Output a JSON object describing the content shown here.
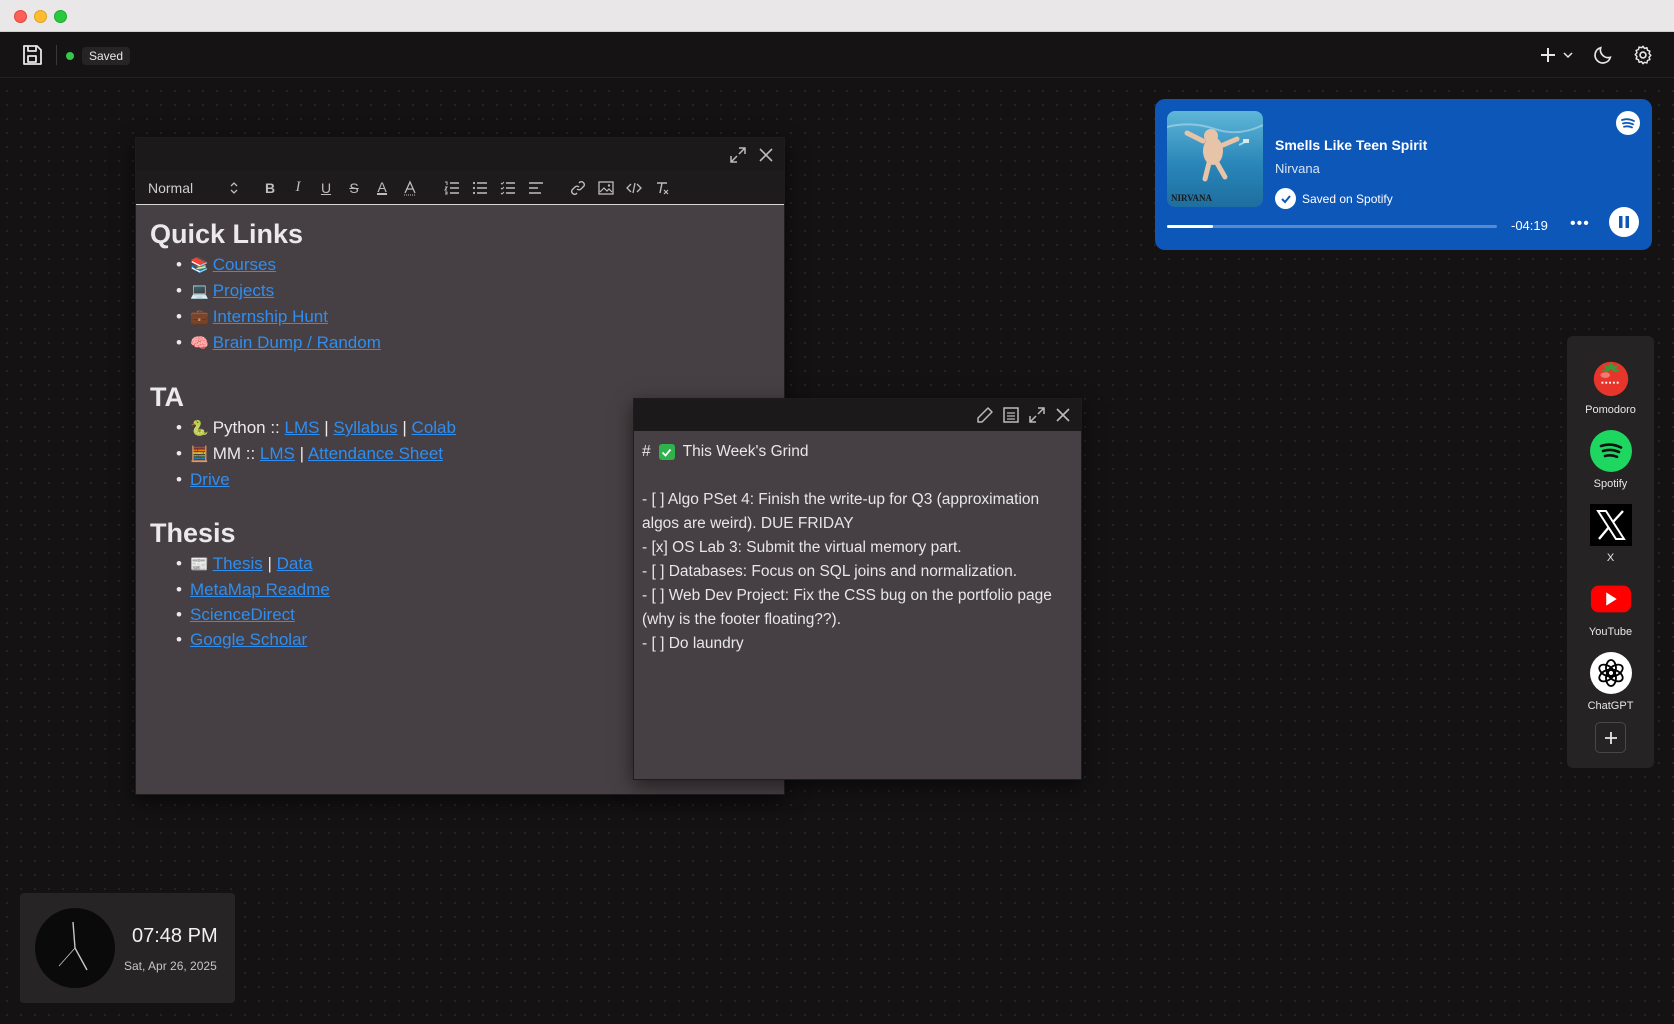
{
  "topbar": {
    "status_label": "Saved",
    "status_color": "#35c64a"
  },
  "editor": {
    "format_select": "Normal",
    "toolbar_icons": [
      "bold-icon",
      "italic-icon",
      "underline-icon",
      "strikethrough-icon",
      "text-color-icon",
      "highlight-icon",
      "ordered-list-icon",
      "bullet-list-icon",
      "check-list-icon",
      "align-icon",
      "link-icon",
      "image-icon",
      "code-icon",
      "clear-format-icon"
    ],
    "quick_links": {
      "heading": "Quick Links",
      "items": [
        {
          "emoji": "📚",
          "label": "Courses"
        },
        {
          "emoji": "💻",
          "label": "Projects"
        },
        {
          "emoji": "💼",
          "label": "Internship Hunt"
        },
        {
          "emoji": "🧠",
          "label": "Brain Dump / Random"
        }
      ]
    },
    "ta": {
      "heading": "TA",
      "python": {
        "emoji": "🐍",
        "prefix": "Python ::",
        "links": [
          "LMS",
          "Syllabus",
          "Colab"
        ],
        "separator": "|"
      },
      "mm": {
        "emoji": "🧮",
        "prefix": "MM ::",
        "links": [
          "LMS",
          "Attendance Sheet"
        ],
        "separator": "|"
      },
      "drive": "Drive"
    },
    "thesis": {
      "heading": "Thesis",
      "row1": {
        "emoji": "📰",
        "links": [
          "Thesis",
          "Data"
        ],
        "separator": "|"
      },
      "items": [
        "MetaMap Readme",
        "ScienceDirect",
        "Google Scholar"
      ]
    }
  },
  "note": {
    "hash": "#",
    "title": "This Week's Grind",
    "lines": [
      "- [ ] Algo PSet 4: Finish the write-up for Q3 (approximation algos are weird). DUE FRIDAY",
      "- [x] OS Lab 3: Submit the virtual memory part.",
      "- [ ] Databases: Focus on SQL joins and normalization.",
      "- [ ] Web Dev Project: Fix the CSS bug on the portfolio page (why is the footer floating??).",
      "- [ ] Do laundry"
    ]
  },
  "spotify": {
    "track": "Smells Like Teen Spirit",
    "artist": "Nirvana",
    "saved_label": "Saved on Spotify",
    "remaining": "-04:19",
    "progress": 0.14,
    "album_caption": "NIRVANA",
    "bg_color": "#0d57b8"
  },
  "dock": {
    "apps": [
      {
        "label": "Pomodoro",
        "icon": "tomato-icon"
      },
      {
        "label": "Spotify",
        "icon": "spotify-icon"
      },
      {
        "label": "X",
        "icon": "x-icon"
      },
      {
        "label": "YouTube",
        "icon": "youtube-icon"
      },
      {
        "label": "ChatGPT",
        "icon": "chatgpt-icon"
      }
    ]
  },
  "clock": {
    "time": "07:48 PM",
    "date": "Sat, Apr 26, 2025"
  }
}
